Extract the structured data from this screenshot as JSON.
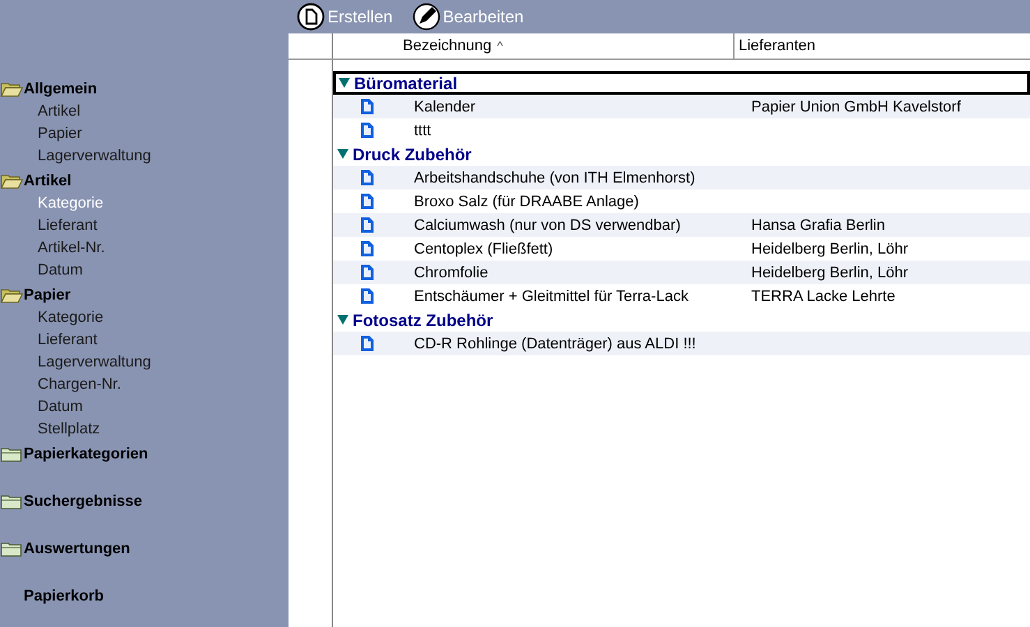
{
  "sidebar": {
    "sections": [
      {
        "label": "Allgemein",
        "kind": "folder",
        "expanded": true,
        "items": [
          {
            "label": "Artikel",
            "selected": false
          },
          {
            "label": "Papier",
            "selected": false
          },
          {
            "label": "Lagerverwaltung",
            "selected": false
          }
        ]
      },
      {
        "label": "Artikel",
        "kind": "folder",
        "expanded": true,
        "items": [
          {
            "label": "Kategorie",
            "selected": true
          },
          {
            "label": "Lieferant",
            "selected": false
          },
          {
            "label": "Artikel-Nr.",
            "selected": false
          },
          {
            "label": "Datum",
            "selected": false
          }
        ]
      },
      {
        "label": "Papier",
        "kind": "folder",
        "expanded": true,
        "items": [
          {
            "label": "Kategorie",
            "selected": false
          },
          {
            "label": "Lieferant",
            "selected": false
          },
          {
            "label": "Lagerverwaltung",
            "selected": false
          },
          {
            "label": "Chargen-Nr.",
            "selected": false
          },
          {
            "label": "Datum",
            "selected": false
          },
          {
            "label": "Stellplatz",
            "selected": false
          }
        ]
      },
      {
        "label": "Papierkategorien",
        "kind": "folder",
        "expanded": false
      },
      {
        "label": "Suchergebnisse",
        "kind": "folder",
        "expanded": false
      },
      {
        "label": "Auswertungen",
        "kind": "folder",
        "expanded": false
      },
      {
        "label": "Papierkorb",
        "kind": "plain"
      }
    ]
  },
  "toolbar": {
    "buttons": [
      {
        "label": "Erstellen",
        "kind": "create"
      },
      {
        "label": "Bearbeiten",
        "kind": "edit"
      }
    ]
  },
  "table": {
    "columns": [
      {
        "label": "Bezeichnung",
        "sort_indicator": "^"
      },
      {
        "label": "Lieferanten"
      }
    ],
    "groups": [
      {
        "label": "Büromaterial",
        "expanded": true,
        "focused": true,
        "rows": [
          {
            "name": "Kalender",
            "supplier": "Papier Union GmbH Kavelstorf"
          },
          {
            "name": "tttt",
            "supplier": ""
          }
        ]
      },
      {
        "label": "Druck Zubehör",
        "expanded": true,
        "focused": false,
        "rows": [
          {
            "name": "Arbeitshandschuhe (von ITH Elmenhorst)",
            "supplier": ""
          },
          {
            "name": "Broxo Salz (für DRAABE Anlage)",
            "supplier": ""
          },
          {
            "name": "Calciumwash (nur von DS verwendbar)",
            "supplier": "Hansa Grafia Berlin"
          },
          {
            "name": "Centoplex (Fließfett)",
            "supplier": "Heidelberg Berlin, Löhr"
          },
          {
            "name": "Chromfolie",
            "supplier": "Heidelberg Berlin, Löhr"
          },
          {
            "name": "Entschäumer + Gleitmittel für Terra-Lack",
            "supplier": "TERRA Lacke Lehrte"
          }
        ]
      },
      {
        "label": "Fotosatz Zubehör",
        "expanded": true,
        "focused": false,
        "rows": [
          {
            "name": "CD-R Rohlinge (Datenträger) aus ALDI !!!",
            "supplier": ""
          }
        ]
      }
    ]
  }
}
